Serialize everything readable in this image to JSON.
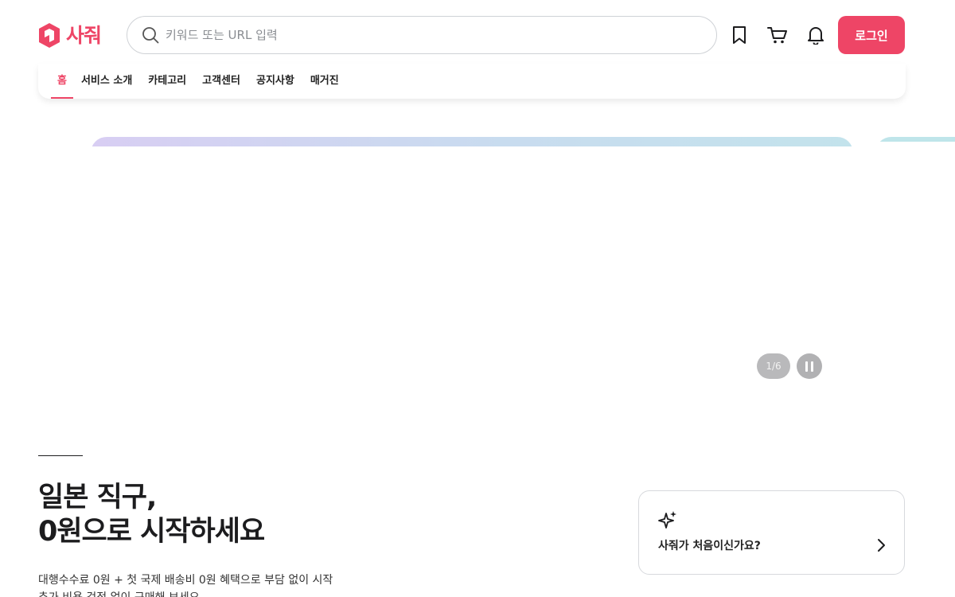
{
  "brand": {
    "name": "사줘",
    "color": "#ee4566"
  },
  "search": {
    "placeholder": "키워드 또는 URL 입력",
    "value": ""
  },
  "header_icons": [
    "bookmark-icon",
    "cart-icon",
    "bell-icon"
  ],
  "login": {
    "label": "로그인"
  },
  "nav": {
    "items": [
      {
        "label": "홈",
        "active": true
      },
      {
        "label": "서비스 소개",
        "active": false
      },
      {
        "label": "카테고리",
        "active": false
      },
      {
        "label": "고객센터",
        "active": false
      },
      {
        "label": "공지사항",
        "active": false
      },
      {
        "label": "매거진",
        "active": false
      }
    ]
  },
  "banner": {
    "pager": "1/6",
    "controls": [
      "pause-icon"
    ]
  },
  "intro": {
    "headline_line1": "일본 직구,",
    "headline_line2": "0원으로 시작하세요",
    "subtext_line1": "대행수수료 0원 + 첫 국제 배송비 0원 혜택으로 부담 없이 시작",
    "subtext_line2": "추가 비용 걱정 없이 구매해 보세요"
  },
  "first_time_card": {
    "label": "사줘가 처음이신가요?",
    "icon": "sparkle-icon"
  }
}
